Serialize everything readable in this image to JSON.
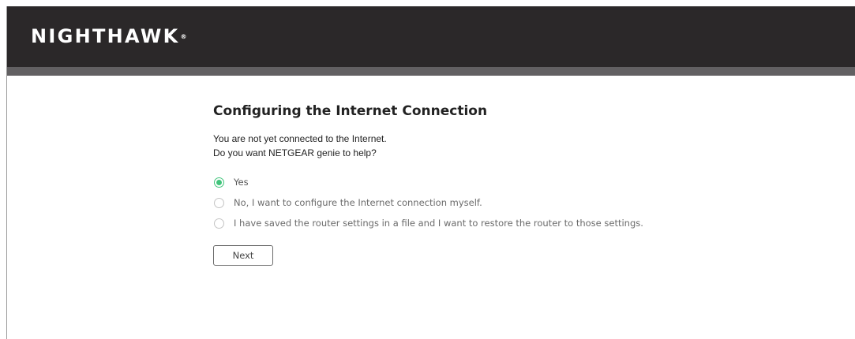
{
  "header": {
    "logo_text": "NIGHTHAWK",
    "logo_mark": "®"
  },
  "main": {
    "title": "Configuring the Internet Connection",
    "intro_line1": "You are not yet connected to the Internet.",
    "intro_line2": "Do you want NETGEAR genie to help?",
    "options": [
      {
        "label": "Yes",
        "selected": true
      },
      {
        "label": "No, I want to configure the Internet connection myself.",
        "selected": false
      },
      {
        "label": "I have saved the router settings in a file and I want to restore the router to those settings.",
        "selected": false
      }
    ],
    "next_label": "Next"
  },
  "colors": {
    "header_bg": "#2b2829",
    "header_strip": "#626062",
    "radio_selected": "#41c47b"
  }
}
